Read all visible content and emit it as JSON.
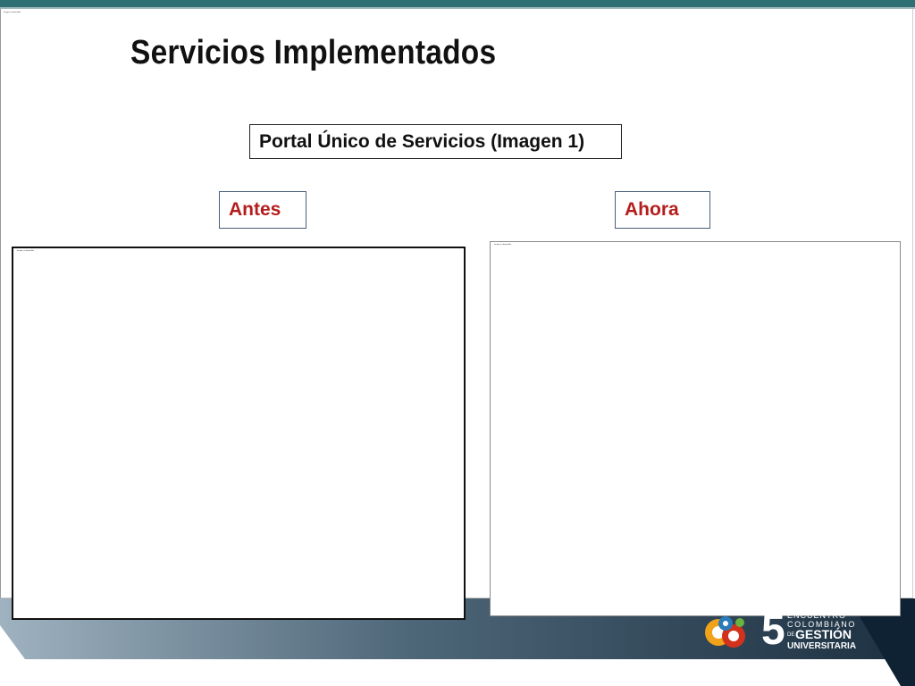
{
  "slide": {
    "title": "Servicios Implementados",
    "subtitle_box": "Portal Único de Servicios (Imagen 1)",
    "before_label": "Antes",
    "after_label": "Ahora",
    "corner_caption": "Imagen no disponible",
    "before_caption": "Imagen no disponible",
    "after_caption": "Imagen no disponible"
  },
  "logo": {
    "number": "5",
    "line1": "ENCUENTRO",
    "line2": "COLOMBIANO",
    "line3_prefix": "DE",
    "line3": "GESTIÓN",
    "line4": "UNIVERSITARIA"
  },
  "colors": {
    "top_bar": "#2e6f73",
    "label_text": "#b51d1d",
    "band_dark": "#1f3447",
    "band_light": "#8aa0b0"
  }
}
